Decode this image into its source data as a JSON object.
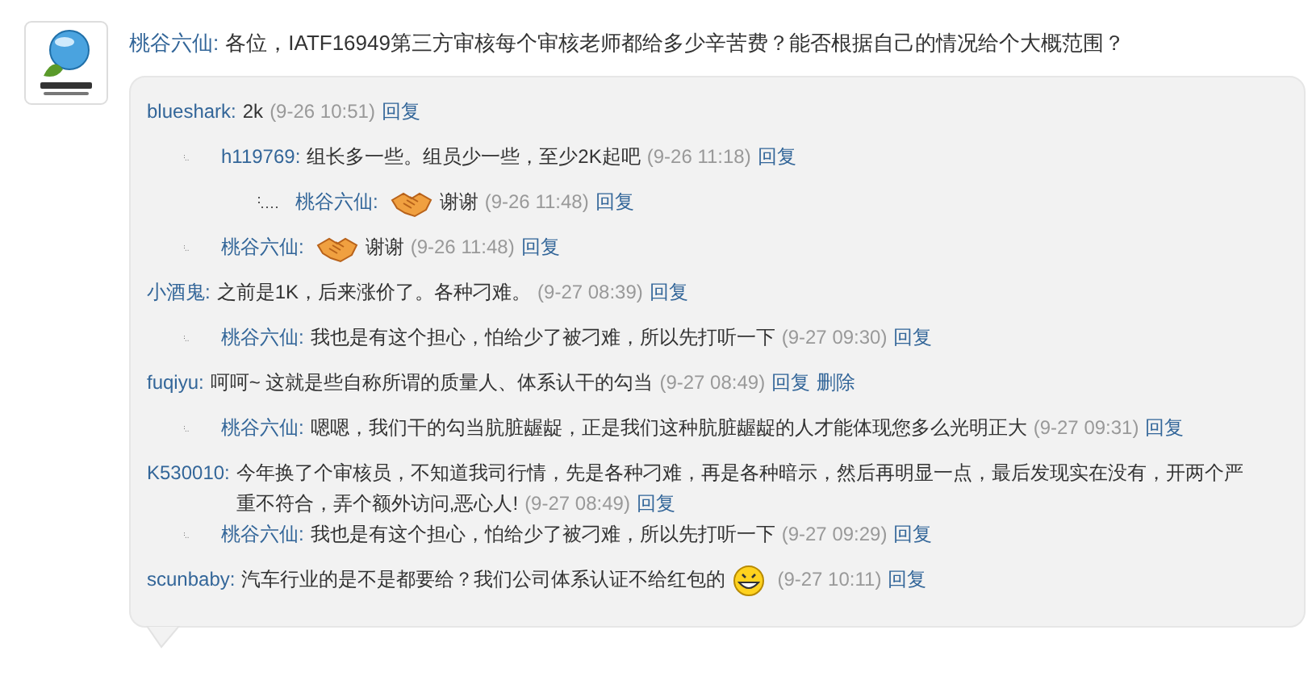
{
  "post": {
    "author": "桃谷六仙:",
    "text": "各位，IATF16949第三方审核每个审核老师都给多少辛苦费？能否根据自己的情况给个大概范围？"
  },
  "comments": [
    {
      "author": "blueshark:",
      "content": [
        {
          "kind": "text",
          "text": "2k"
        }
      ],
      "time": "(9-26 10:51)",
      "actions": [
        "回复"
      ],
      "children": [
        {
          "author": "h119769:",
          "content": [
            {
              "kind": "text",
              "text": "组长多一些。组员少一些，至少2K起吧"
            }
          ],
          "time": "(9-26 11:18)",
          "actions": [
            "回复"
          ],
          "children": [
            {
              "author": "桃谷六仙:",
              "content": [
                {
                  "kind": "handshake"
                },
                {
                  "kind": "text",
                  "text": "谢谢"
                }
              ],
              "time": "(9-26 11:48)",
              "actions": [
                "回复"
              ]
            }
          ]
        },
        {
          "author": "桃谷六仙:",
          "content": [
            {
              "kind": "handshake"
            },
            {
              "kind": "text",
              "text": "谢谢"
            }
          ],
          "time": "(9-26 11:48)",
          "actions": [
            "回复"
          ]
        }
      ]
    },
    {
      "author": "小酒鬼:",
      "content": [
        {
          "kind": "text",
          "text": "之前是1K，后来涨价了。各种刁难。"
        }
      ],
      "time": "(9-27 08:39)",
      "actions": [
        "回复"
      ],
      "children": [
        {
          "author": "桃谷六仙:",
          "content": [
            {
              "kind": "text",
              "text": "我也是有这个担心，怕给少了被刁难，所以先打听一下"
            }
          ],
          "time": "(9-27 09:30)",
          "actions": [
            "回复"
          ]
        }
      ]
    },
    {
      "author": "fuqiyu:",
      "content": [
        {
          "kind": "text",
          "text": "呵呵~  这就是些自称所谓的质量人、体系认干的勾当"
        }
      ],
      "time": "(9-27 08:49)",
      "actions": [
        "回复",
        "删除"
      ],
      "children": [
        {
          "author": "桃谷六仙:",
          "content": [
            {
              "kind": "text",
              "text": "嗯嗯，我们干的勾当肮脏龌龊，正是我们这种肮脏龌龊的人才能体现您多么光明正大"
            }
          ],
          "time": "(9-27 09:31)",
          "actions": [
            "回复"
          ]
        }
      ]
    },
    {
      "author": "K530010:",
      "content": [
        {
          "kind": "line",
          "text": "今年换了个审核员，不知道我司行情，先是各种刁难，再是各种暗示，然后再明显一点，最后发现实在没有，开两个严"
        },
        {
          "kind": "text",
          "text": "重不符合，弄个额外访问,恶心人!"
        }
      ],
      "time": "(9-27 08:49)",
      "actions": [
        "回复"
      ],
      "children": [
        {
          "author": "桃谷六仙:",
          "content": [
            {
              "kind": "text",
              "text": "我也是有这个担心，怕给少了被刁难，所以先打听一下"
            }
          ],
          "time": "(9-27 09:29)",
          "actions": [
            "回复"
          ]
        }
      ]
    },
    {
      "author": "scunbaby:",
      "content": [
        {
          "kind": "text",
          "text": "汽车行业的是不是都要给？我们公司体系认证不给红包的"
        },
        {
          "kind": "grin"
        }
      ],
      "time": "(9-27 10:11)",
      "actions": [
        "回复"
      ]
    }
  ]
}
